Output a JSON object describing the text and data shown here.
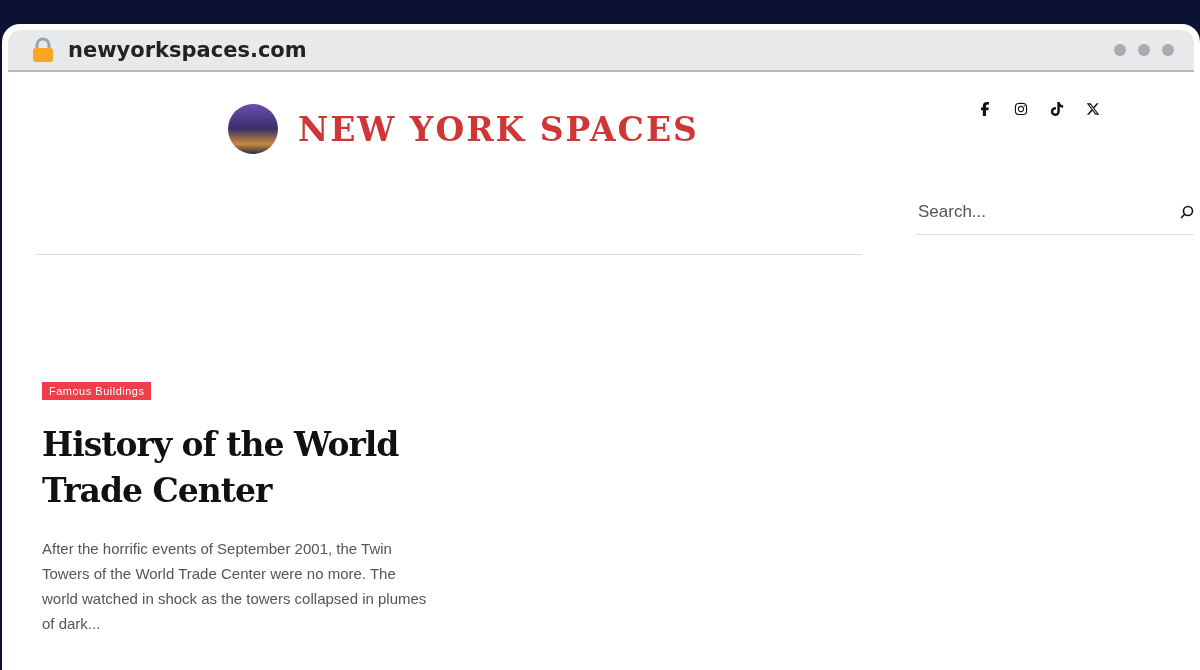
{
  "browser": {
    "url": "newyorkspaces.com"
  },
  "site": {
    "title": "NEW YORK SPACES"
  },
  "search": {
    "placeholder": "Search..."
  },
  "article": {
    "category": "Famous Buildings",
    "title": "History of the World Trade Center",
    "excerpt": "After the horrific events of September 2001, the Twin Towers of the World Trade Center were no more. The world watched in shock as the towers collapsed in plumes of dark..."
  }
}
